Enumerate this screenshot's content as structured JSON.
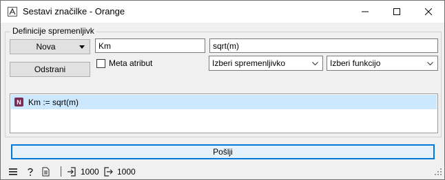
{
  "window": {
    "title": "Sestavi značilke - Orange"
  },
  "group": {
    "title": "Definicije spremenljivk"
  },
  "buttons": {
    "new_label": "Nova",
    "remove_label": "Odstrani",
    "send_label": "Pošlji"
  },
  "inputs": {
    "name_value": "Km",
    "expression_value": "sqrt(m)"
  },
  "checkbox": {
    "meta_label": "Meta atribut",
    "checked": false
  },
  "combos": {
    "variable_selected": "Izberi spremenljivko",
    "function_selected": "Izberi funkcijo"
  },
  "features": [
    {
      "type_badge": "N",
      "text": "Km := sqrt(m)"
    }
  ],
  "status": {
    "input_count": "1000",
    "output_count": "1000"
  },
  "icons": {
    "app": "orange-app-icon",
    "minimize": "minimize-icon",
    "maximize": "maximize-icon",
    "close": "close-icon",
    "menu": "hamburger-menu-icon",
    "help": "help-icon",
    "report": "report-icon",
    "input": "input-signal-icon",
    "output": "output-signal-icon"
  },
  "colors": {
    "selection": "#cce8ff",
    "accent": "#0078d7",
    "numeric_badge": "#7b2d55"
  }
}
